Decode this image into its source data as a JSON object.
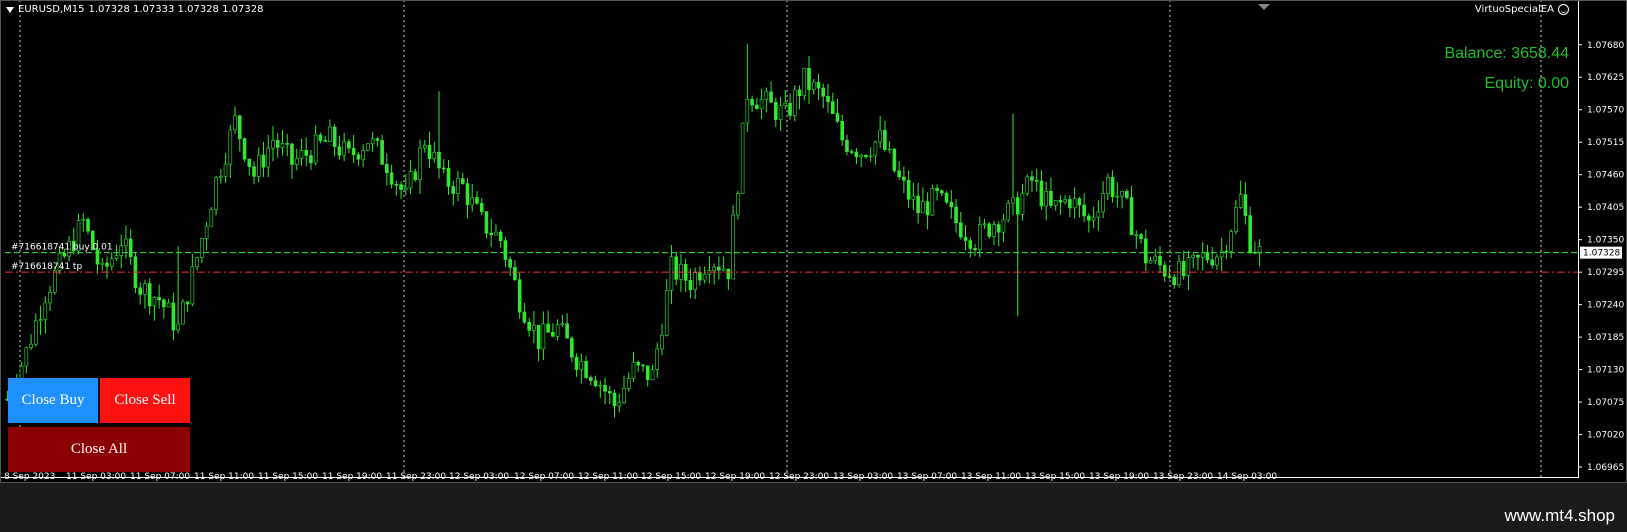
{
  "chart": {
    "symbol_info": "EURUSD,M15",
    "ohlc_info": "1.07328 1.07333 1.07328 1.07328",
    "expert_name": "VirtuoSpecialEA",
    "current_price_label": "1.07328"
  },
  "account": {
    "balance_text": "Balance: 3658.44",
    "equity_text": "Equity: 0.00"
  },
  "orders": {
    "entry_label": "#716618741 buy 0.01",
    "tp_label": "#716618741 tp"
  },
  "buttons": {
    "close_buy": "Close Buy",
    "close_sell": "Close Sell",
    "close_all": "Close All"
  },
  "watermark": "www.mt4.shop",
  "colors": {
    "background": "#000000",
    "candles": "#32e632",
    "entry_line": "#32e632",
    "tp_line": "#ff2a2a",
    "balance_text": "#1fbf2a",
    "close_buy": "#1e90ff",
    "close_sell": "#ff1111",
    "close_all": "#8b0000"
  },
  "chart_data": {
    "type": "candlestick",
    "price_axis_labels": [
      "1.07680",
      "1.07625",
      "1.07570",
      "1.07515",
      "1.07460",
      "1.07405",
      "1.07350",
      "1.07295",
      "1.07240",
      "1.07185",
      "1.07130",
      "1.07075",
      "1.07020",
      "1.06965"
    ],
    "time_axis_labels": [
      "8 Sep 2023",
      "11 Sep 03:00",
      "11 Sep 07:00",
      "11 Sep 11:00",
      "11 Sep 15:00",
      "11 Sep 19:00",
      "11 Sep 23:00",
      "12 Sep 03:00",
      "12 Sep 07:00",
      "12 Sep 11:00",
      "12 Sep 15:00",
      "12 Sep 19:00",
      "12 Sep 23:00",
      "13 Sep 03:00",
      "13 Sep 07:00",
      "13 Sep 11:00",
      "13 Sep 15:00",
      "13 Sep 19:00",
      "13 Sep 23:00",
      "14 Sep 03:00"
    ],
    "ylim": [
      1.0696,
      1.07705
    ],
    "entry_price": 1.07328,
    "tp_price": 1.07295,
    "close_price_path": [
      {
        "t": 0,
        "p": 1.0708
      },
      {
        "t": 4,
        "p": 1.0716
      },
      {
        "t": 8,
        "p": 1.0726
      },
      {
        "t": 12,
        "p": 1.0732
      },
      {
        "t": 16,
        "p": 1.0738
      },
      {
        "t": 20,
        "p": 1.0729
      },
      {
        "t": 24,
        "p": 1.0735
      },
      {
        "t": 28,
        "p": 1.0727
      },
      {
        "t": 32,
        "p": 1.0725
      },
      {
        "t": 36,
        "p": 1.072
      },
      {
        "t": 40,
        "p": 1.0732
      },
      {
        "t": 44,
        "p": 1.0745
      },
      {
        "t": 48,
        "p": 1.0755
      },
      {
        "t": 52,
        "p": 1.0746
      },
      {
        "t": 56,
        "p": 1.0752
      },
      {
        "t": 60,
        "p": 1.0748
      },
      {
        "t": 64,
        "p": 1.075
      },
      {
        "t": 68,
        "p": 1.0752
      },
      {
        "t": 72,
        "p": 1.0749
      },
      {
        "t": 76,
        "p": 1.0752
      },
      {
        "t": 80,
        "p": 1.0748
      },
      {
        "t": 84,
        "p": 1.0742
      },
      {
        "t": 88,
        "p": 1.0752
      },
      {
        "t": 92,
        "p": 1.0745
      },
      {
        "t": 96,
        "p": 1.0744
      },
      {
        "t": 100,
        "p": 1.0738
      },
      {
        "t": 104,
        "p": 1.0735
      },
      {
        "t": 108,
        "p": 1.0725
      },
      {
        "t": 112,
        "p": 1.0718
      },
      {
        "t": 116,
        "p": 1.072
      },
      {
        "t": 120,
        "p": 1.0715
      },
      {
        "t": 124,
        "p": 1.0712
      },
      {
        "t": 128,
        "p": 1.0707
      },
      {
        "t": 132,
        "p": 1.0713
      },
      {
        "t": 136,
        "p": 1.0712
      },
      {
        "t": 140,
        "p": 1.073
      },
      {
        "t": 144,
        "p": 1.0728
      },
      {
        "t": 148,
        "p": 1.0732
      },
      {
        "t": 152,
        "p": 1.073
      },
      {
        "t": 156,
        "p": 1.076
      },
      {
        "t": 160,
        "p": 1.0758
      },
      {
        "t": 164,
        "p": 1.0756
      },
      {
        "t": 168,
        "p": 1.0762
      },
      {
        "t": 172,
        "p": 1.0759
      },
      {
        "t": 176,
        "p": 1.0752
      },
      {
        "t": 180,
        "p": 1.075
      },
      {
        "t": 184,
        "p": 1.0752
      },
      {
        "t": 188,
        "p": 1.0745
      },
      {
        "t": 192,
        "p": 1.074
      },
      {
        "t": 196,
        "p": 1.0742
      },
      {
        "t": 200,
        "p": 1.0738
      },
      {
        "t": 204,
        "p": 1.0735
      },
      {
        "t": 208,
        "p": 1.0738
      },
      {
        "t": 212,
        "p": 1.074
      },
      {
        "t": 216,
        "p": 1.0745
      },
      {
        "t": 220,
        "p": 1.074
      },
      {
        "t": 224,
        "p": 1.0742
      },
      {
        "t": 228,
        "p": 1.0738
      },
      {
        "t": 232,
        "p": 1.0745
      },
      {
        "t": 236,
        "p": 1.074
      },
      {
        "t": 240,
        "p": 1.0732
      },
      {
        "t": 244,
        "p": 1.073
      },
      {
        "t": 248,
        "p": 1.0729
      },
      {
        "t": 252,
        "p": 1.0732
      },
      {
        "t": 256,
        "p": 1.0733
      },
      {
        "t": 260,
        "p": 1.0742
      },
      {
        "t": 262,
        "p": 1.0735
      },
      {
        "t": 264,
        "p": 1.07328
      }
    ]
  }
}
